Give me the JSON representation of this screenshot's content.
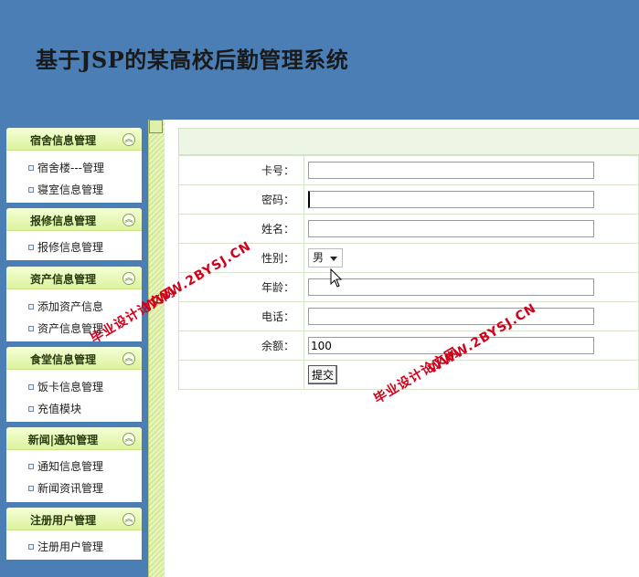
{
  "header": {
    "title": "基于JSP的某高校后勤管理系统"
  },
  "sidebar": {
    "panels": [
      {
        "title": "宿舍信息管理",
        "items": [
          "宿舍楼---管理",
          "寝室信息管理"
        ]
      },
      {
        "title": "报修信息管理",
        "items": [
          "报修信息管理"
        ]
      },
      {
        "title": "资产信息管理",
        "items": [
          "添加资产信息",
          "资产信息管理"
        ]
      },
      {
        "title": "食堂信息管理",
        "items": [
          "饭卡信息管理",
          "充值模块"
        ]
      },
      {
        "title": "新闻|通知管理",
        "items": [
          "通知信息管理",
          "新闻资讯管理"
        ]
      },
      {
        "title": "注册用户管理",
        "items": [
          "注册用户管理"
        ]
      }
    ],
    "collapse_glyph": "︽"
  },
  "form": {
    "card": {
      "label": "卡号：",
      "value": ""
    },
    "password": {
      "label": "密码：",
      "value": ""
    },
    "name": {
      "label": "姓名：",
      "value": ""
    },
    "gender": {
      "label": "性别：",
      "value": "男"
    },
    "age": {
      "label": "年龄：",
      "value": ""
    },
    "phone": {
      "label": "电话：",
      "value": ""
    },
    "balance": {
      "label": "余额：",
      "value": "100"
    },
    "submit_label": "提交"
  },
  "watermarks": {
    "cn": "毕业设计论文网",
    "url": "WWW.2BYSJ.CN"
  },
  "colors": {
    "header_bg": "#4a7eb4",
    "panel_head": "#ddf39e",
    "watermark": "#d0021b"
  }
}
